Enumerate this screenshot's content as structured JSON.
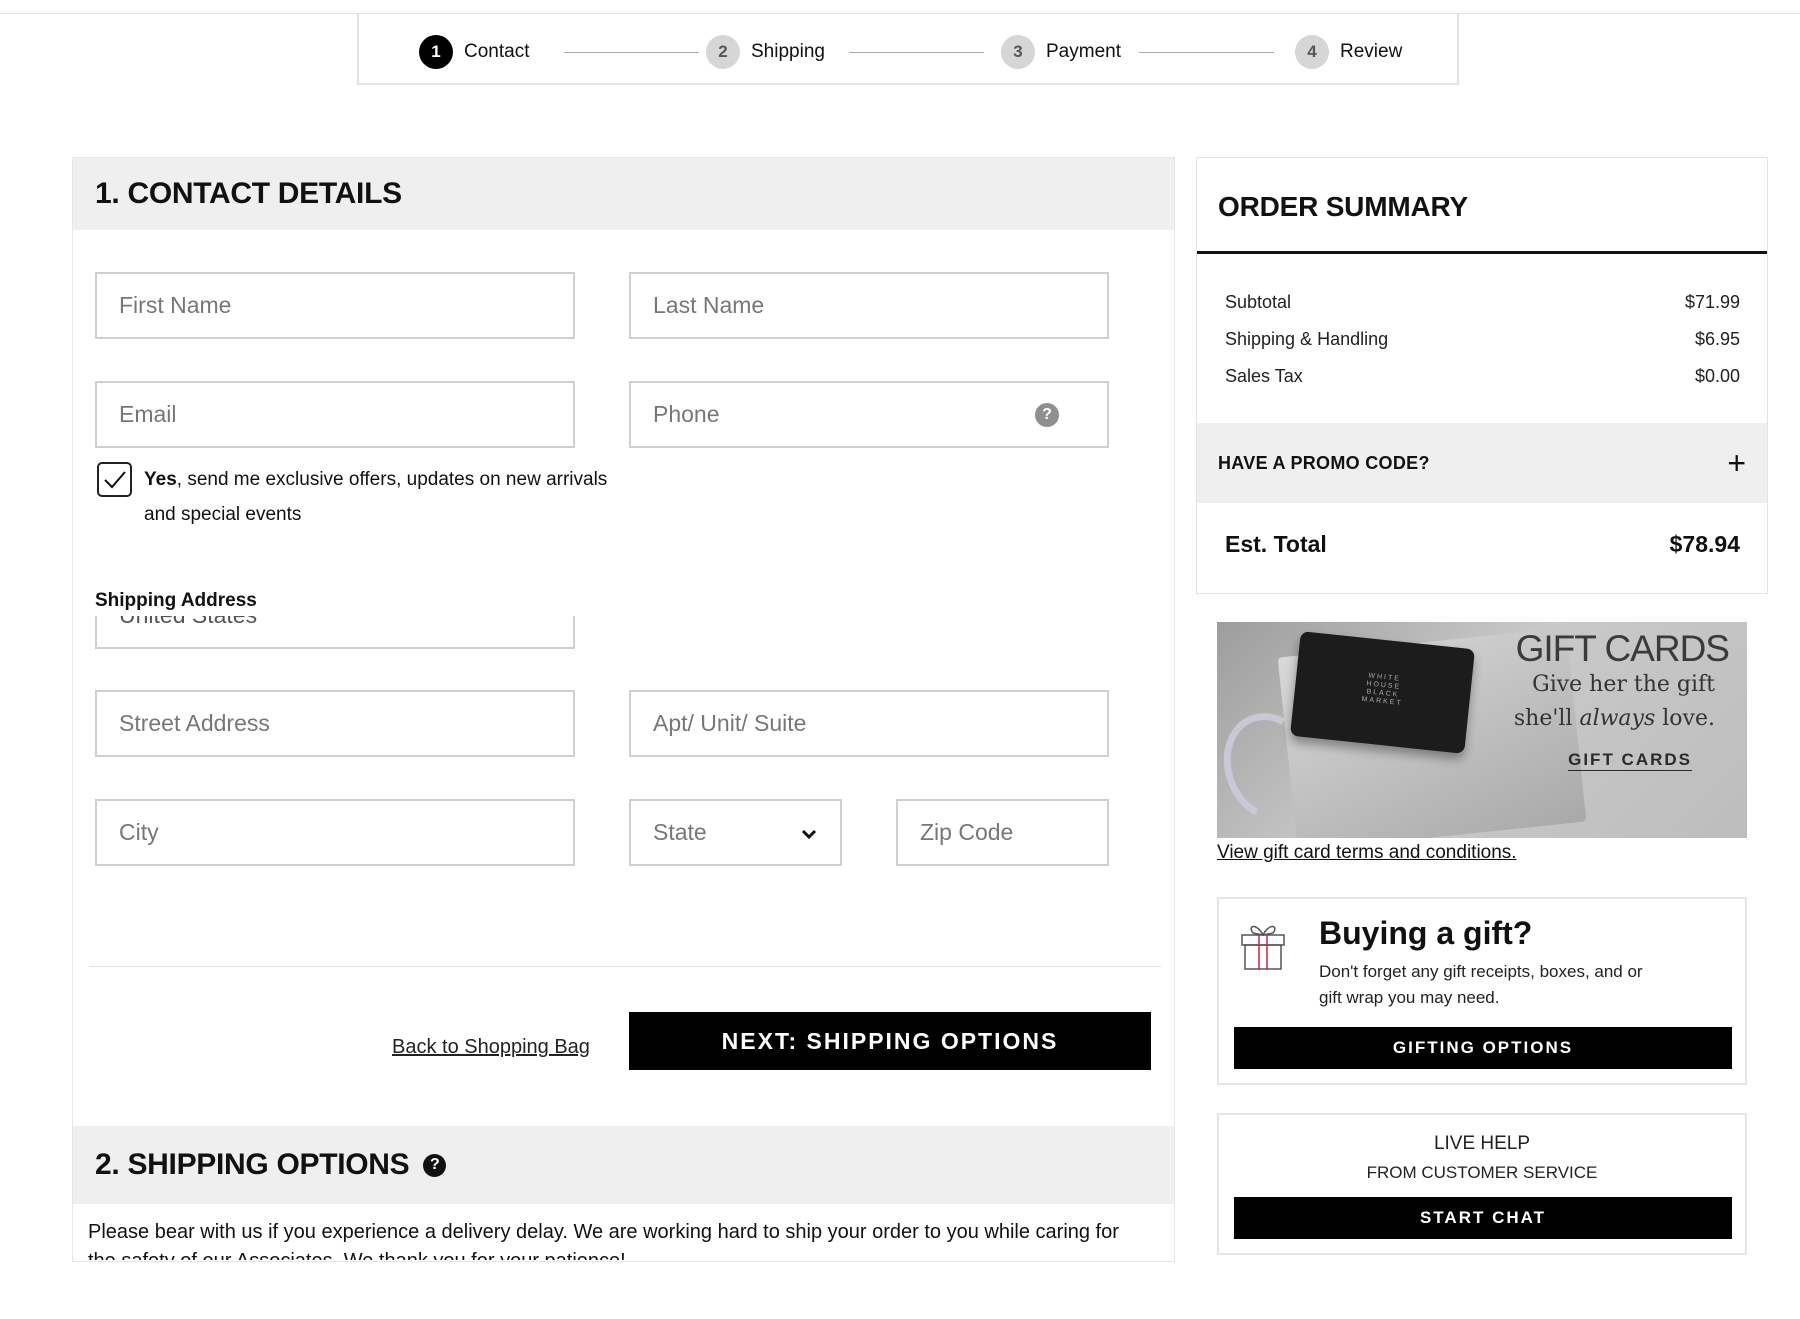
{
  "progress": {
    "steps": [
      {
        "num": "1",
        "label": "Contact",
        "active": true
      },
      {
        "num": "2",
        "label": "Shipping",
        "active": false
      },
      {
        "num": "3",
        "label": "Payment",
        "active": false
      },
      {
        "num": "4",
        "label": "Review",
        "active": false
      }
    ]
  },
  "contact": {
    "title": "1. CONTACT DETAILS",
    "fields": {
      "first_name": "First Name",
      "last_name": "Last Name",
      "email": "Email",
      "phone": "Phone",
      "phone_help_icon": "question-icon"
    },
    "optin": {
      "checked": true,
      "bold": "Yes",
      "text": ", send me exclusive offers, updates on new arrivals and special events"
    },
    "shipping_address_label": "Shipping Address",
    "country_value": "United States",
    "address_fields": {
      "street": "Street Address",
      "apt": "Apt/ Unit/ Suite",
      "city": "City",
      "state": "State",
      "zip": "Zip Code"
    },
    "back_link": "Back to Shopping Bag",
    "next_button": "NEXT: SHIPPING OPTIONS"
  },
  "shipping_options": {
    "title": "2. SHIPPING OPTIONS",
    "notice": "Please bear with us if you experience a delivery delay. We are working hard to ship your order to you while caring for the safety of our Associates. We thank you for your patience!"
  },
  "order_summary": {
    "title": "ORDER SUMMARY",
    "rows": [
      {
        "label": "Subtotal",
        "value": "$71.99"
      },
      {
        "label": "Shipping & Handling",
        "value": "$6.95"
      },
      {
        "label": "Sales Tax",
        "value": "$0.00"
      }
    ],
    "promo_label": "HAVE A PROMO CODE?",
    "promo_icon": "+",
    "est_total_label": "Est. Total",
    "est_total_value": "$78.94"
  },
  "gift_banner": {
    "title": "GIFT CARDS",
    "subtitle_1": "Give her the gift",
    "subtitle_2_pre": "she'll ",
    "subtitle_2_em": "always",
    "subtitle_2_post": " love.",
    "link": "GIFT CARDS",
    "card_logo": "WHITE HOUSE BLACK MARKET",
    "terms_link": "View gift card terms and conditions."
  },
  "buying_gift": {
    "title": "Buying a gift?",
    "text": "Don't forget any gift receipts, boxes, and or gift wrap you may need.",
    "button": "GIFTING OPTIONS"
  },
  "live_help": {
    "title": "LIVE HELP",
    "subtitle": "FROM CUSTOMER SERVICE",
    "button": "START CHAT"
  },
  "colors": {
    "accent": "#000000",
    "panel_header": "#efefef",
    "border": "#cfcfcf"
  }
}
